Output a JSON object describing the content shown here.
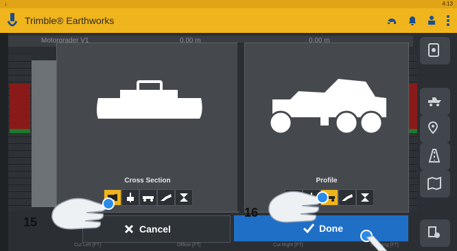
{
  "status_bar": {
    "time": "4:13",
    "download_glyph": "↓"
  },
  "app": {
    "title": "Trimble® Earthworks"
  },
  "background_readouts": {
    "left_name": "Motorgrader V1",
    "val1": "0.00 m",
    "val2": "0.00 m"
  },
  "panels": {
    "cross_section": {
      "label": "Cross Section"
    },
    "profile": {
      "label": "Profile"
    }
  },
  "actions": {
    "cancel_label": "Cancel",
    "done_label": "Done"
  },
  "bottom_labels": {
    "cut_left": "Cut Left [FT]",
    "offline": "Offline [FT]",
    "cut_right": "Cut Right [FT]",
    "northing": "Northing [FT]"
  },
  "callouts": {
    "step_15": "15",
    "step_16": "16"
  },
  "colors": {
    "accent": "#f0b41c",
    "done_blue": "#1f6fc7",
    "selected": "#f0b41c"
  },
  "icons": [
    "download-icon",
    "trimble-logo",
    "headset-icon",
    "bell-icon",
    "person-icon",
    "more-icon",
    "settings-icon",
    "machine-icon",
    "location-icon",
    "road-icon",
    "map-icon",
    "gear-icon",
    "close-icon",
    "check-icon"
  ]
}
